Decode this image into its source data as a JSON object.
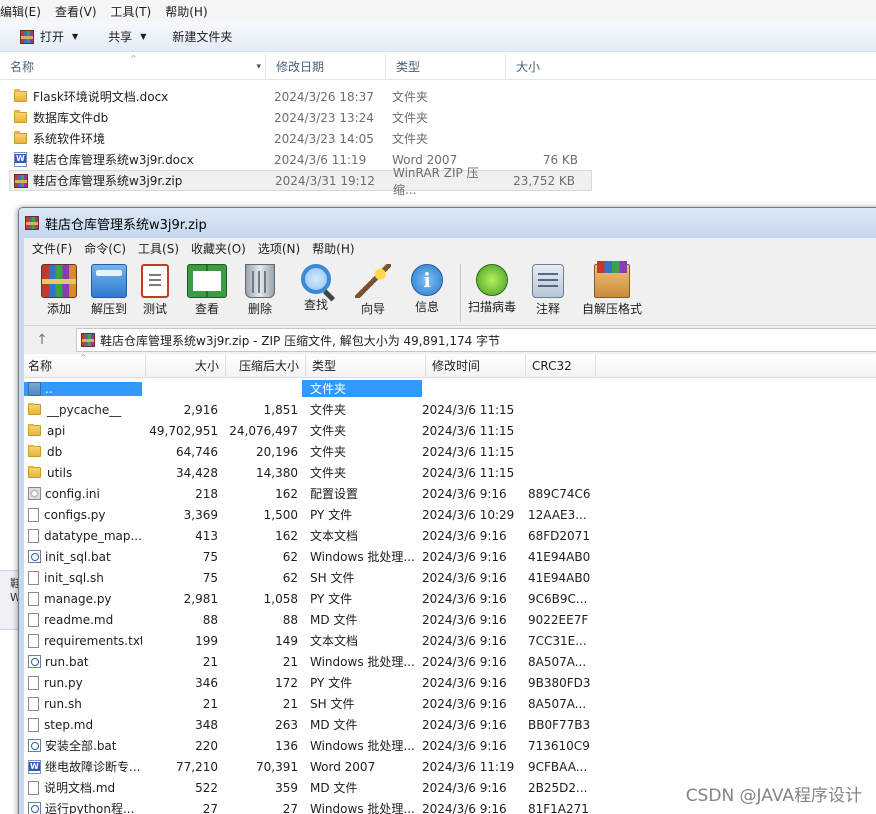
{
  "explorer": {
    "menu": [
      "编辑(E)",
      "查看(V)",
      "工具(T)",
      "帮助(H)"
    ],
    "toolbar": {
      "open": "打开",
      "share": "共享",
      "new_folder": "新建文件夹"
    },
    "columns": {
      "name": "名称",
      "date": "修改日期",
      "type": "类型",
      "size": "大小"
    },
    "rows": [
      {
        "icon": "folder-icon",
        "name": "Flask环境说明文档.docx",
        "date": "2024/3/26 18:37",
        "type": "文件夹",
        "size": ""
      },
      {
        "icon": "folder-icon",
        "name": "数据库文件db",
        "date": "2024/3/23 13:24",
        "type": "文件夹",
        "size": ""
      },
      {
        "icon": "folder-icon",
        "name": "系统软件环境",
        "date": "2024/3/23 14:05",
        "type": "文件夹",
        "size": ""
      },
      {
        "icon": "word-doc-icon",
        "name": "鞋店仓库管理系统w3j9r.docx",
        "date": "2024/3/6 11:19",
        "type": "Word 2007",
        "size": "76 KB"
      },
      {
        "icon": "winrar-archive-icon",
        "name": "鞋店仓库管理系统w3j9r.zip",
        "date": "2024/3/31 19:12",
        "type": "WinRAR ZIP 压缩...",
        "size": "23,752 KB"
      }
    ],
    "sliver_text": "鞋\nW"
  },
  "winrar": {
    "title": "鞋店仓库管理系统w3j9r.zip",
    "menu": [
      "文件(F)",
      "命令(C)",
      "工具(S)",
      "收藏夹(O)",
      "选项(N)",
      "帮助(H)"
    ],
    "tools": [
      {
        "label": "添加",
        "icon": "add-archive-icon"
      },
      {
        "label": "解压到",
        "icon": "extract-to-icon"
      },
      {
        "label": "测试",
        "icon": "test-icon"
      },
      {
        "label": "查看",
        "icon": "view-icon"
      },
      {
        "label": "删除",
        "icon": "delete-icon"
      },
      {
        "label": "查找",
        "icon": "find-icon"
      },
      {
        "label": "向导",
        "icon": "wizard-icon"
      },
      {
        "label": "信息",
        "icon": "info-icon"
      },
      {
        "label": "扫描病毒",
        "icon": "virus-scan-icon"
      },
      {
        "label": "注释",
        "icon": "comment-icon"
      },
      {
        "label": "自解压格式",
        "icon": "sfx-icon"
      }
    ],
    "address": "鞋店仓库管理系统w3j9r.zip - ZIP 压缩文件, 解包大小为 49,891,174 字节",
    "columns": {
      "name": "名称",
      "size": "大小",
      "csize": "压缩后大小",
      "type": "类型",
      "date": "修改时间",
      "crc": "CRC32"
    },
    "rows": [
      {
        "icon": "up-folder",
        "name": "..",
        "size": "",
        "csize": "",
        "type": "文件夹",
        "date": "",
        "crc": "",
        "selected": true
      },
      {
        "icon": "folder",
        "name": "__pycache__",
        "size": "2,916",
        "csize": "1,851",
        "type": "文件夹",
        "date": "2024/3/6 11:15",
        "crc": ""
      },
      {
        "icon": "folder",
        "name": "api",
        "size": "49,702,951",
        "csize": "24,076,497",
        "type": "文件夹",
        "date": "2024/3/6 11:15",
        "crc": ""
      },
      {
        "icon": "folder",
        "name": "db",
        "size": "64,746",
        "csize": "20,196",
        "type": "文件夹",
        "date": "2024/3/6 11:15",
        "crc": ""
      },
      {
        "icon": "folder",
        "name": "utils",
        "size": "34,428",
        "csize": "14,380",
        "type": "文件夹",
        "date": "2024/3/6 11:15",
        "crc": ""
      },
      {
        "icon": "gear",
        "name": "config.ini",
        "size": "218",
        "csize": "162",
        "type": "配置设置",
        "date": "2024/3/6 9:16",
        "crc": "889C74C6"
      },
      {
        "icon": "file",
        "name": "configs.py",
        "size": "3,369",
        "csize": "1,500",
        "type": "PY 文件",
        "date": "2024/3/6 10:29",
        "crc": "12AAE3..."
      },
      {
        "icon": "file",
        "name": "datatype_map....",
        "size": "413",
        "csize": "162",
        "type": "文本文档",
        "date": "2024/3/6 9:16",
        "crc": "68FD2071"
      },
      {
        "icon": "bat",
        "name": "init_sql.bat",
        "size": "75",
        "csize": "62",
        "type": "Windows 批处理...",
        "date": "2024/3/6 9:16",
        "crc": "41E94AB0"
      },
      {
        "icon": "file",
        "name": "init_sql.sh",
        "size": "75",
        "csize": "62",
        "type": "SH 文件",
        "date": "2024/3/6 9:16",
        "crc": "41E94AB0"
      },
      {
        "icon": "file",
        "name": "manage.py",
        "size": "2,981",
        "csize": "1,058",
        "type": "PY 文件",
        "date": "2024/3/6 9:16",
        "crc": "9C6B9C..."
      },
      {
        "icon": "file",
        "name": "readme.md",
        "size": "88",
        "csize": "88",
        "type": "MD 文件",
        "date": "2024/3/6 9:16",
        "crc": "9022EE7F"
      },
      {
        "icon": "file",
        "name": "requirements.txt",
        "size": "199",
        "csize": "149",
        "type": "文本文档",
        "date": "2024/3/6 9:16",
        "crc": "7CC31E..."
      },
      {
        "icon": "bat",
        "name": "run.bat",
        "size": "21",
        "csize": "21",
        "type": "Windows 批处理...",
        "date": "2024/3/6 9:16",
        "crc": "8A507A..."
      },
      {
        "icon": "file",
        "name": "run.py",
        "size": "346",
        "csize": "172",
        "type": "PY 文件",
        "date": "2024/3/6 9:16",
        "crc": "9B380FD3"
      },
      {
        "icon": "file",
        "name": "run.sh",
        "size": "21",
        "csize": "21",
        "type": "SH 文件",
        "date": "2024/3/6 9:16",
        "crc": "8A507A..."
      },
      {
        "icon": "file",
        "name": "step.md",
        "size": "348",
        "csize": "263",
        "type": "MD 文件",
        "date": "2024/3/6 9:16",
        "crc": "BB0F77B3"
      },
      {
        "icon": "bat",
        "name": "安装全部.bat",
        "size": "220",
        "csize": "136",
        "type": "Windows 批处理...",
        "date": "2024/3/6 9:16",
        "crc": "713610C9"
      },
      {
        "icon": "word",
        "name": "继电故障诊断专...",
        "size": "77,210",
        "csize": "70,391",
        "type": "Word 2007",
        "date": "2024/3/6 11:19",
        "crc": "9CFBAA..."
      },
      {
        "icon": "file",
        "name": "说明文档.md",
        "size": "522",
        "csize": "359",
        "type": "MD 文件",
        "date": "2024/3/6 9:16",
        "crc": "2B25D2..."
      },
      {
        "icon": "bat",
        "name": "运行python程...",
        "size": "27",
        "csize": "27",
        "type": "Windows 批处理...",
        "date": "2024/3/6 9:16",
        "crc": "81F1A271"
      }
    ]
  },
  "watermark": "CSDN @JAVA程序设计"
}
